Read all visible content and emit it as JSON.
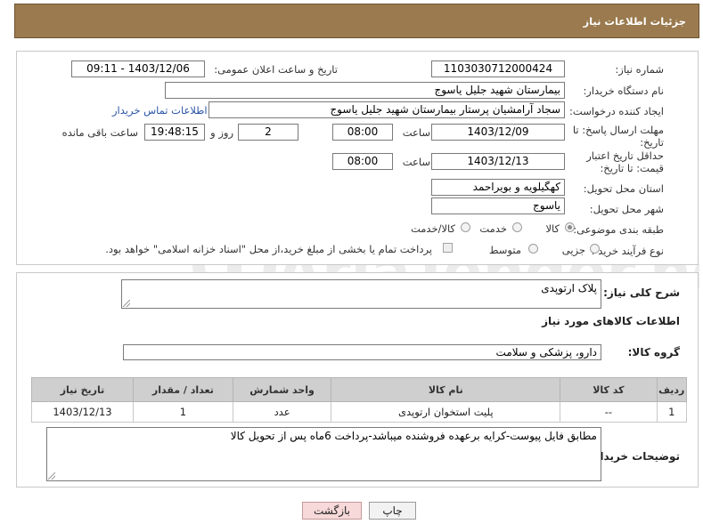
{
  "header": {
    "title": "جزئیات اطلاعات نیاز"
  },
  "form": {
    "need_number_label": "شماره نیاز:",
    "need_number": "1103030712000424",
    "announce_label": "تاریخ و ساعت اعلان عمومی:",
    "announce_value": "1403/12/06 - 09:11",
    "buyer_org_label": "نام دستگاه خریدار:",
    "buyer_org": "بیمارستان شهید جلیل یاسوج",
    "creator_label": "ایجاد کننده درخواست:",
    "creator": "سجاد آرامشیان پرستار بیمارستان شهید جلیل یاسوج",
    "contact_link": "اطلاعات تماس خریدار",
    "deadline_label": "مهلت ارسال پاسخ: تا تاریخ:",
    "deadline_date": "1403/12/09",
    "time_label": "ساعت",
    "deadline_time": "08:00",
    "days_value": "2",
    "days_label": "روز و",
    "remaining_time": "19:48:15",
    "remaining_label": "ساعت باقی مانده",
    "price_validity_label": "حداقل تاریخ اعتبار قیمت: تا تاریخ:",
    "price_validity_date": "1403/12/13",
    "price_validity_time": "08:00",
    "province_label": "استان محل تحویل:",
    "province": "کهگیلویه و بویراحمد",
    "city_label": "شهر محل تحویل:",
    "city": "یاسوج",
    "category_label": "طبقه بندی موضوعی:",
    "category_options": [
      "کالا",
      "خدمت",
      "کالا/خدمت"
    ],
    "process_label": "نوع فرآیند خرید :",
    "process_options": [
      "جزیی",
      "متوسط"
    ],
    "payment_note": "پرداخت تمام یا بخشی از مبلغ خرید،از محل \"اسناد خزانه اسلامی\" خواهد بود."
  },
  "details": {
    "summary_label": "شرح کلی نیاز:",
    "summary": "پلاک ارتوپدی",
    "goods_info_label": "اطلاعات کالاهای مورد نیاز",
    "goods_group_label": "گروه کالا:",
    "goods_group": "دارو، پزشکی و سلامت",
    "table": {
      "headers": [
        "ردیف",
        "کد کالا",
        "نام کالا",
        "واحد شمارش",
        "تعداد / مقدار",
        "تاریخ نیاز"
      ],
      "rows": [
        [
          "1",
          "--",
          "پلیت استخوان ارتوپدی",
          "عدد",
          "1",
          "1403/12/13"
        ]
      ]
    },
    "buyer_notes_label": "توضیحات خریدار:",
    "buyer_notes": "مطابق فایل پیوست-کرایه برعهده فروشنده میباشد-پرداخت 6ماه پس از تحویل کالا"
  },
  "buttons": {
    "print": "چاپ",
    "back": "بازگشت"
  },
  "watermark": {
    "text": "AriaTender.neT"
  },
  "colors": {
    "header_bg": "#9a7a4e",
    "back_btn_bg": "#f7d9d9",
    "link": "#2a54a8"
  }
}
